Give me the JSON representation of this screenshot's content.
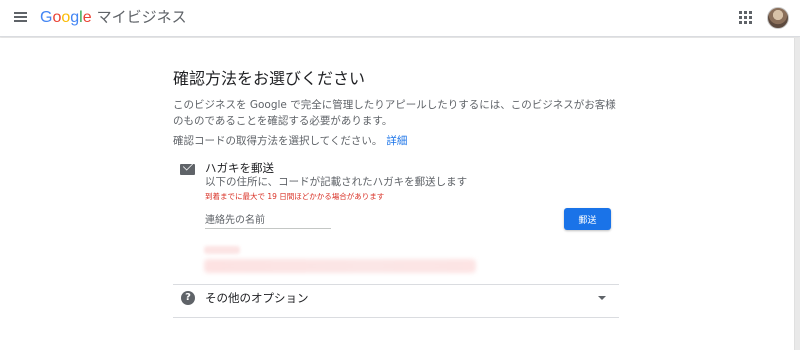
{
  "header": {
    "logo_letters": [
      "G",
      "o",
      "o",
      "g",
      "l",
      "e"
    ],
    "logo_colors": [
      "#4285f4",
      "#ea4335",
      "#fbbc05",
      "#4285f4",
      "#34a853",
      "#ea4335"
    ],
    "product_name": "マイビジネス"
  },
  "page": {
    "title": "確認方法をお選びください",
    "description": "このビジネスを Google で完全に管理したりアピールしたりするには、このビジネスがお客様のものであることを確認する必要があります。",
    "prompt": "確認コードの取得方法を選択してください。",
    "details_link": "詳細"
  },
  "postcard_option": {
    "title": "ハガキを郵送",
    "subtitle": "以下の住所に、コードが記載されたハガキを郵送します",
    "warning": "到着までに最大で 19 日間ほどかかる場合があります",
    "name_placeholder": "連絡先の名前",
    "name_value": "",
    "send_label": "郵送"
  },
  "other_options": {
    "label": "その他のオプション"
  },
  "icons": {
    "menu": "menu-icon",
    "apps": "apps-grid-icon",
    "mail": "mail-icon",
    "help": "help-icon",
    "expand": "chevron-down-icon"
  },
  "colors": {
    "accent": "#1a73e8",
    "warning": "#d93025"
  }
}
